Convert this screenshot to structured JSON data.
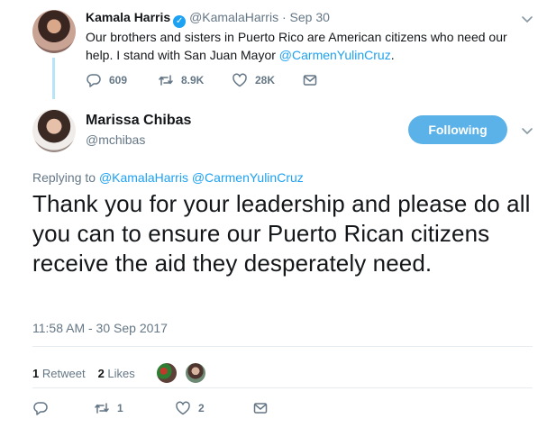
{
  "parent_tweet": {
    "author_name": "Kamala Harris",
    "author_handle": "@KamalaHarris",
    "date": "Sep 30",
    "text_part1": "Our brothers and sisters in Puerto Rico are American citizens who need our help. I stand with San Juan Mayor ",
    "mention": "@CarmenYulinCruz",
    "text_part2": ".",
    "replies": "609",
    "retweets": "8.9K",
    "likes": "28K"
  },
  "main_tweet": {
    "author_name": "Marissa Chibas",
    "author_handle": "@mchibas",
    "follow_label": "Following",
    "replying_prefix": "Replying to",
    "replying_mention1": "@KamalaHarris",
    "replying_mention2": "@CarmenYulinCruz",
    "text": "Thank you for your leadership and please do all you can to ensure our Puerto Rican citizens receive the aid they desperately need.",
    "timestamp": "11:58 AM - 30 Sep 2017",
    "retweet_count": "1",
    "retweet_label": "Retweet",
    "like_count": "2",
    "like_label": "Likes",
    "action_retweets": "1",
    "action_likes": "2"
  },
  "colors": {
    "accent": "#1da1f2",
    "follow_button": "#5ab2e8",
    "muted": "#657786",
    "thread_line": "#b9e3f6"
  },
  "icons": [
    "verified-badge-icon",
    "chevron-down-icon",
    "reply-icon",
    "retweet-icon",
    "like-icon",
    "direct-message-icon"
  ]
}
